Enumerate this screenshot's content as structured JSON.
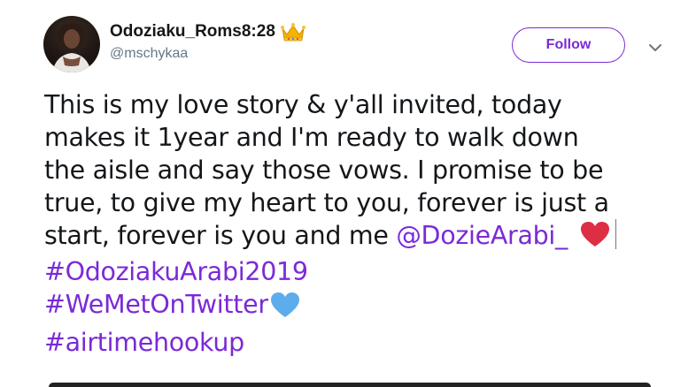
{
  "tweet": {
    "display_name": "Odoziaku_Roms8:28",
    "handle": "@mschykaa",
    "follow_label": "Follow",
    "body": {
      "line1": "This is my love story & y'all invited, today",
      "line2": "makes it 1year and I'm ready to walk down",
      "line3": "the aisle and say those vows. I promise to be",
      "line4": "true, to give my heart to you, forever is just a",
      "line5_text": "start, forever is you and me ",
      "mention": "@DozieArabi_",
      "hashtags": [
        "#OdoziakuArabi2019",
        "#WeMetOnTwitter",
        "#airtimehookup"
      ]
    }
  },
  "icons": {
    "crown": "crown-emoji-icon",
    "red_heart": "red-heart-emoji-icon",
    "blue_heart": "blue-heart-emoji-icon",
    "caret": "chevron-down-icon"
  },
  "colors": {
    "accent": "#7b2ad6",
    "text": "#14171a",
    "secondary": "#657786",
    "red_heart": "#dd2e44",
    "blue_heart": "#5dadec"
  }
}
